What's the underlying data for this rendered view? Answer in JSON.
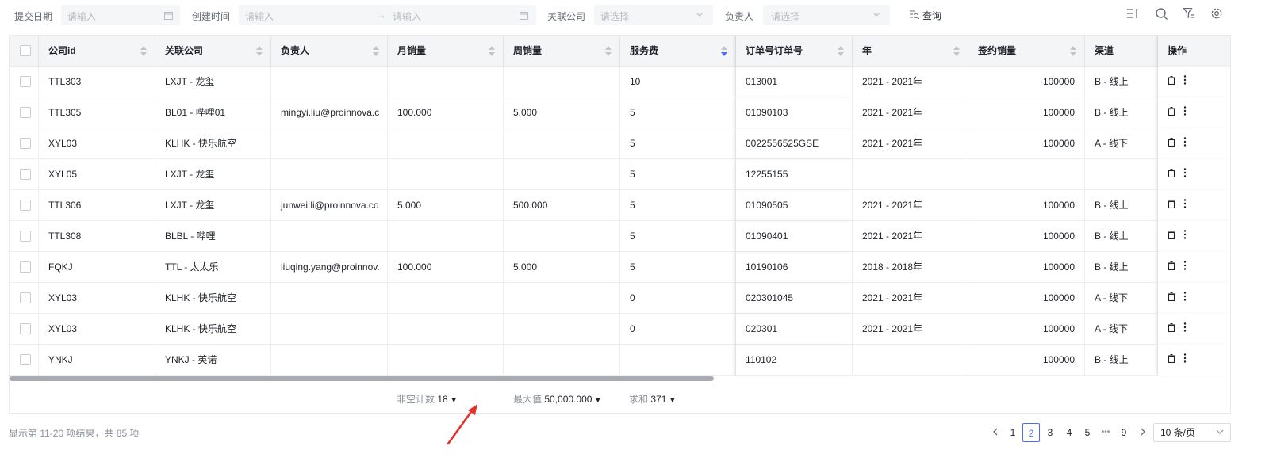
{
  "filters": {
    "submit_date_label": "提交日期",
    "submit_date_placeholder": "请输入",
    "created_time_label": "创建时间",
    "created_time_start_placeholder": "请输入",
    "created_time_range_sep": "→",
    "created_time_end_placeholder": "请输入",
    "company_label": "关联公司",
    "company_placeholder": "请选择",
    "owner_label": "负责人",
    "owner_placeholder": "请选择",
    "query_label": "查询"
  },
  "toolbar_icons": [
    "column-settings-icon",
    "search-icon",
    "filter-icon",
    "settings-icon"
  ],
  "columns": [
    "公司id",
    "关联公司",
    "负责人",
    "月销量",
    "周销量",
    "服务费",
    "订单号订单号",
    "年",
    "签约销量",
    "渠道",
    "操作"
  ],
  "rows": [
    {
      "company_id": "TTL303",
      "company": "LXJT - 龙玺",
      "owner": "",
      "monthly": "",
      "weekly": "",
      "fee": "10",
      "order_no": "013001",
      "year": "2021 - 2021年",
      "signed": "100000",
      "channel": "B - 线上"
    },
    {
      "company_id": "TTL305",
      "company": "BL01 - 哔哩01",
      "owner": "mingyi.liu@proinnova.c",
      "monthly": "100.000",
      "weekly": "5.000",
      "fee": "5",
      "order_no": "01090103",
      "year": "2021 - 2021年",
      "signed": "100000",
      "channel": "B - 线上"
    },
    {
      "company_id": "XYL03",
      "company": "KLHK - 快乐航空",
      "owner": "",
      "monthly": "",
      "weekly": "",
      "fee": "5",
      "order_no": "0022556525GSE",
      "year": "2021 - 2021年",
      "signed": "100000",
      "channel": "A - 线下"
    },
    {
      "company_id": "XYL05",
      "company": "LXJT - 龙玺",
      "owner": "",
      "monthly": "",
      "weekly": "",
      "fee": "5",
      "order_no": "12255155",
      "year": "",
      "signed": "",
      "channel": ""
    },
    {
      "company_id": "TTL306",
      "company": "LXJT - 龙玺",
      "owner": "junwei.li@proinnova.co",
      "monthly": "5.000",
      "weekly": "500.000",
      "fee": "5",
      "order_no": "01090505",
      "year": "2021 - 2021年",
      "signed": "100000",
      "channel": "B - 线上"
    },
    {
      "company_id": "TTL308",
      "company": "BLBL - 哔哩",
      "owner": "",
      "monthly": "",
      "weekly": "",
      "fee": "5",
      "order_no": "01090401",
      "year": "2021 - 2021年",
      "signed": "100000",
      "channel": "B - 线上"
    },
    {
      "company_id": "FQKJ",
      "company": "TTL - 太太乐",
      "owner": "liuqing.yang@proinnov.",
      "monthly": "100.000",
      "weekly": "5.000",
      "fee": "5",
      "order_no": "10190106",
      "year": "2018 - 2018年",
      "signed": "100000",
      "channel": "B - 线上"
    },
    {
      "company_id": "XYL03",
      "company": "KLHK - 快乐航空",
      "owner": "",
      "monthly": "",
      "weekly": "",
      "fee": "0",
      "order_no": "020301045",
      "year": "2021 - 2021年",
      "signed": "100000",
      "channel": "A - 线下"
    },
    {
      "company_id": "XYL03",
      "company": "KLHK - 快乐航空",
      "owner": "",
      "monthly": "",
      "weekly": "",
      "fee": "0",
      "order_no": "020301",
      "year": "2021 - 2021年",
      "signed": "100000",
      "channel": "A - 线下"
    },
    {
      "company_id": "YNKJ",
      "company": "YNKJ - 英诺",
      "owner": "",
      "monthly": "",
      "weekly": "",
      "fee": "",
      "order_no": "110102",
      "year": "",
      "signed": "100000",
      "channel": "B - 线上"
    }
  ],
  "summary": {
    "nonempty_label": "非空计数",
    "nonempty_value": "18",
    "max_label": "最大值",
    "max_value": "50,000.000",
    "sum_label": "求和",
    "sum_value": "371"
  },
  "footer": {
    "info": "显示第 11-20 项结果，共 85 项",
    "pages": [
      "1",
      "2",
      "3",
      "4",
      "5",
      "•••",
      "9"
    ],
    "current_page": "2",
    "page_size": "10 条/页"
  },
  "colors": {
    "accent": "#4a6cf7",
    "arrow": "#e8302a"
  }
}
